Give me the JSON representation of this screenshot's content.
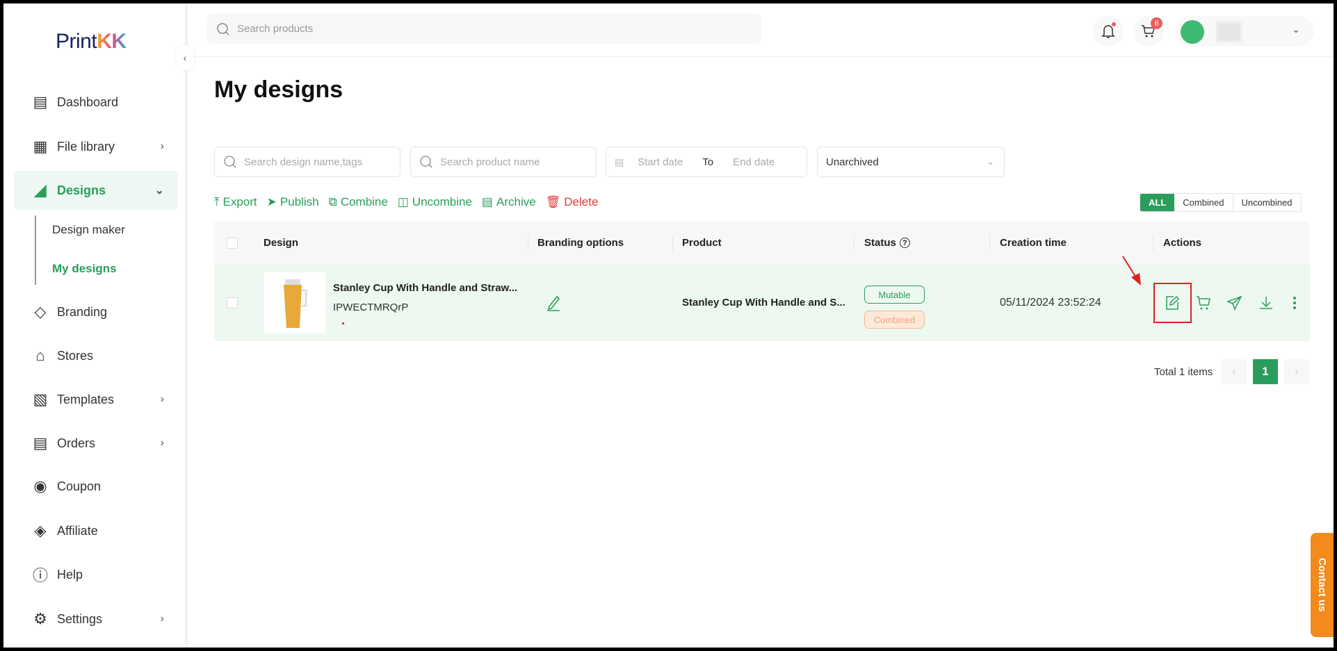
{
  "brand": {
    "name_part1": "Print",
    "name_part2": "KK"
  },
  "header": {
    "search_placeholder": "Search products",
    "cart_count": "6"
  },
  "sidebar": {
    "items": [
      {
        "label": "Dashboard",
        "icon": "dashboard-icon"
      },
      {
        "label": "File library",
        "icon": "image-icon"
      },
      {
        "label": "Designs",
        "icon": "designs-icon"
      },
      {
        "label": "Branding",
        "icon": "tag-icon"
      },
      {
        "label": "Stores",
        "icon": "store-icon"
      },
      {
        "label": "Templates",
        "icon": "templates-icon"
      },
      {
        "label": "Orders",
        "icon": "orders-icon"
      },
      {
        "label": "Coupon",
        "icon": "coupon-icon"
      },
      {
        "label": "Affiliate",
        "icon": "affiliate-icon"
      },
      {
        "label": "Help",
        "icon": "help-icon"
      },
      {
        "label": "Settings",
        "icon": "gear-icon"
      }
    ],
    "sub_items": [
      {
        "label": "Design maker"
      },
      {
        "label": "My designs"
      }
    ]
  },
  "page": {
    "title": "My designs"
  },
  "filters": {
    "design_search_placeholder": "Search design name,tags",
    "product_search_placeholder": "Search product name",
    "start_date_placeholder": "Start date",
    "to": "To",
    "end_date_placeholder": "End date",
    "archive_select": "Unarchived"
  },
  "toolbar": {
    "export": "Export",
    "publish": "Publish",
    "combine": "Combine",
    "uncombine": "Uncombine",
    "archive": "Archive",
    "delete": "Delete"
  },
  "segments": {
    "all": "ALL",
    "combined": "Combined",
    "uncombined": "Uncombined"
  },
  "table": {
    "headers": {
      "design": "Design",
      "branding": "Branding options",
      "product": "Product",
      "status": "Status",
      "creation": "Creation time",
      "actions": "Actions"
    },
    "rows": [
      {
        "design_name": "Stanley Cup With Handle and Straw...",
        "design_id": "IPWECTMRQrP",
        "product": "Stanley Cup With Handle and S...",
        "status_1": "Mutable",
        "status_2": "Combined",
        "created": "05/11/2024 23:52:24"
      }
    ]
  },
  "pagination": {
    "total": "Total 1 items",
    "current": "1"
  },
  "contact": {
    "label": "Contact us"
  },
  "colors": {
    "accent": "#2a9d5c",
    "danger": "#e03c3c",
    "highlight": "#e02020"
  }
}
